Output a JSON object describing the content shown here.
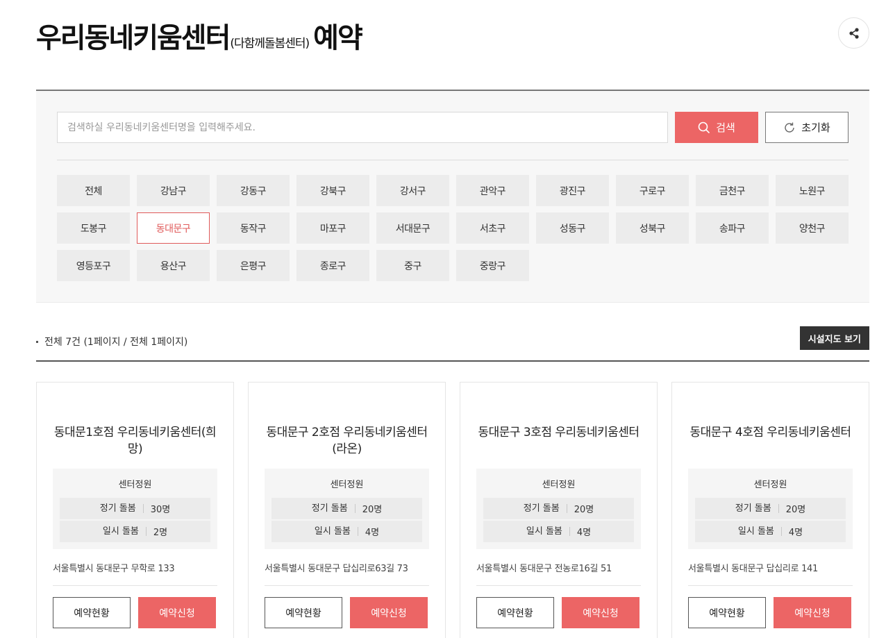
{
  "header": {
    "title_main": "우리동네키움센터",
    "title_sub": "(다함께돌봄센터)",
    "title_end": "예약",
    "share_icon": "share-icon"
  },
  "search": {
    "placeholder": "검색하실 우리동네키움센터명을 입력해주세요.",
    "value": "",
    "search_label": "검색",
    "reset_label": "초기화",
    "search_icon": "search-icon",
    "reset_icon": "refresh-icon"
  },
  "districts": [
    {
      "label": "전체",
      "selected": false
    },
    {
      "label": "강남구",
      "selected": false
    },
    {
      "label": "강동구",
      "selected": false
    },
    {
      "label": "강북구",
      "selected": false
    },
    {
      "label": "강서구",
      "selected": false
    },
    {
      "label": "관악구",
      "selected": false
    },
    {
      "label": "광진구",
      "selected": false
    },
    {
      "label": "구로구",
      "selected": false
    },
    {
      "label": "금천구",
      "selected": false
    },
    {
      "label": "노원구",
      "selected": false
    },
    {
      "label": "도봉구",
      "selected": false
    },
    {
      "label": "동대문구",
      "selected": true
    },
    {
      "label": "동작구",
      "selected": false
    },
    {
      "label": "마포구",
      "selected": false
    },
    {
      "label": "서대문구",
      "selected": false
    },
    {
      "label": "서초구",
      "selected": false
    },
    {
      "label": "성동구",
      "selected": false
    },
    {
      "label": "성북구",
      "selected": false
    },
    {
      "label": "송파구",
      "selected": false
    },
    {
      "label": "양천구",
      "selected": false
    },
    {
      "label": "영등포구",
      "selected": false
    },
    {
      "label": "용산구",
      "selected": false
    },
    {
      "label": "은평구",
      "selected": false
    },
    {
      "label": "종로구",
      "selected": false
    },
    {
      "label": "중구",
      "selected": false
    },
    {
      "label": "중랑구",
      "selected": false
    }
  ],
  "results": {
    "summary": "전체 7건 (1페이지 / 전체 1페이지)",
    "map_button": "시설지도 보기"
  },
  "cards": [
    {
      "title": "동대문1호점 우리동네키움센터(희망)",
      "capacity_title": "센터정원",
      "regular_label": "정기 돌봄",
      "regular_value": "30명",
      "temp_label": "일시 돌봄",
      "temp_value": "2명",
      "address": "서울특별시 동대문구 무학로 133",
      "status_label": "예약현황",
      "apply_label": "예약신청"
    },
    {
      "title": "동대문구 2호점 우리동네키움센터(라온)",
      "capacity_title": "센터정원",
      "regular_label": "정기 돌봄",
      "regular_value": "20명",
      "temp_label": "일시 돌봄",
      "temp_value": "4명",
      "address": "서울특별시 동대문구 답십리로63길 73",
      "status_label": "예약현황",
      "apply_label": "예약신청"
    },
    {
      "title": "동대문구 3호점 우리동네키움센터",
      "capacity_title": "센터정원",
      "regular_label": "정기 돌봄",
      "regular_value": "20명",
      "temp_label": "일시 돌봄",
      "temp_value": "4명",
      "address": "서울특별시 동대문구 전농로16길 51",
      "status_label": "예약현황",
      "apply_label": "예약신청"
    },
    {
      "title": "동대문구 4호점 우리동네키움센터",
      "capacity_title": "센터정원",
      "regular_label": "정기 돌봄",
      "regular_value": "20명",
      "temp_label": "일시 돌봄",
      "temp_value": "4명",
      "address": "서울특별시 동대문구 답십리로 141",
      "status_label": "예약현황",
      "apply_label": "예약신청"
    }
  ],
  "colors": {
    "accent": "#ec6565",
    "selected_border": "#e05a5a",
    "dark_button": "#333333",
    "panel_bg": "#f7f7f7"
  }
}
